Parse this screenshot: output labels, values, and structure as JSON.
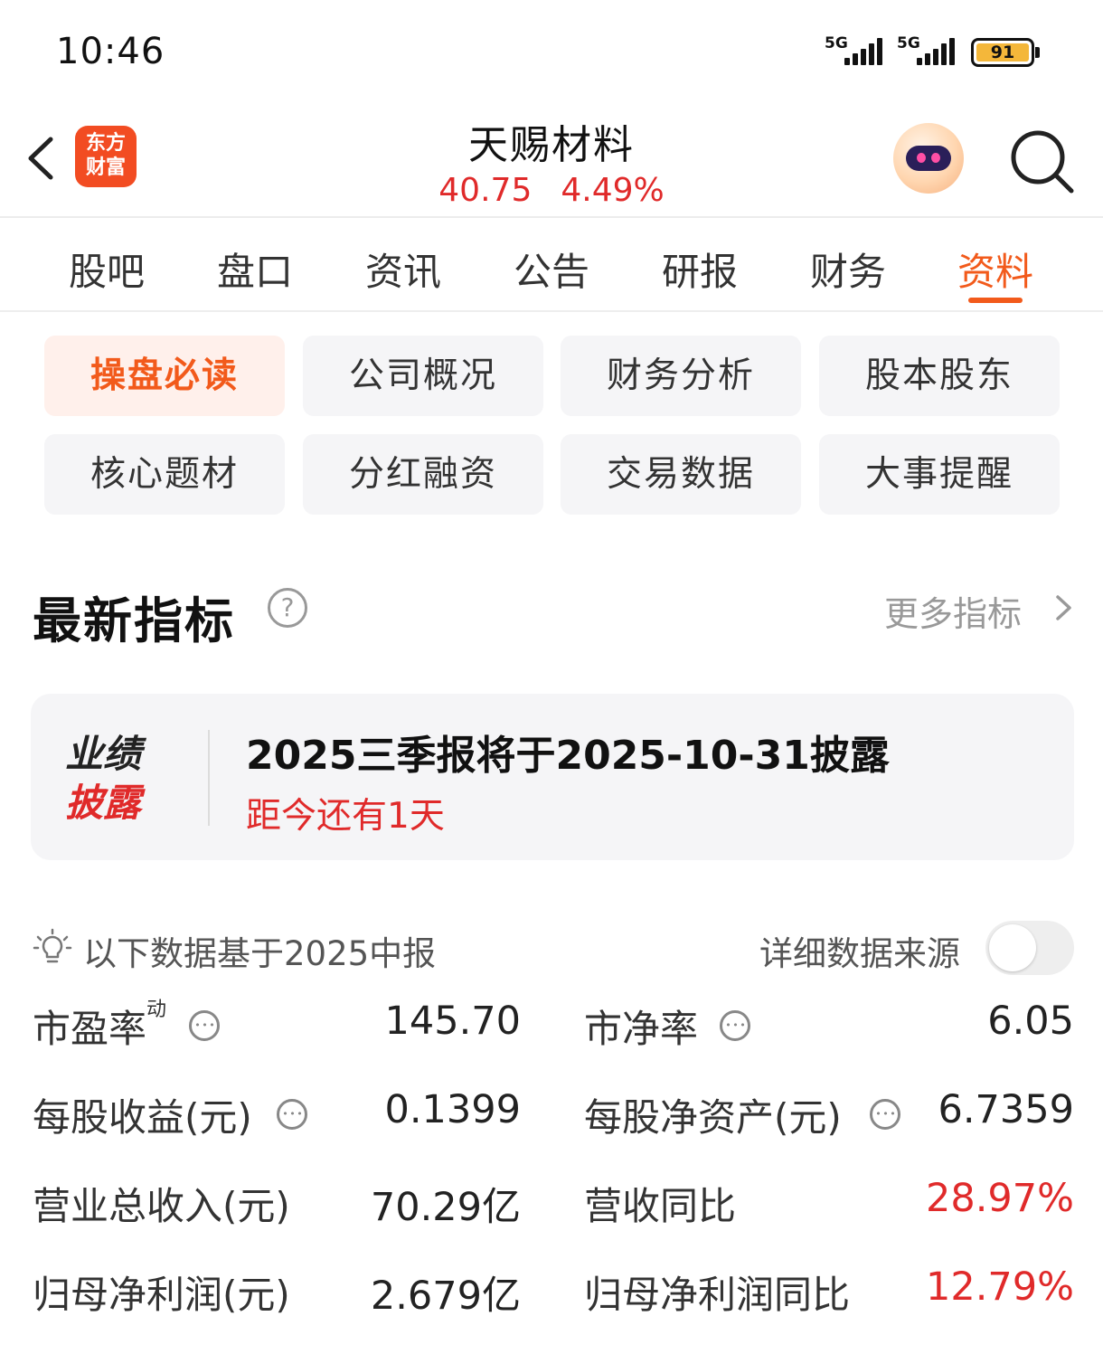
{
  "status_bar": {
    "time": "10:46",
    "signal_1": "5G",
    "signal_2": "5G",
    "battery": "91"
  },
  "header": {
    "logo_line1": "东方",
    "logo_line2": "财富",
    "stock_name": "天赐材料",
    "price": "40.75",
    "change_pct": "4.49%"
  },
  "tabs": [
    {
      "label": "股吧"
    },
    {
      "label": "盘口"
    },
    {
      "label": "资讯"
    },
    {
      "label": "公告"
    },
    {
      "label": "研报"
    },
    {
      "label": "财务"
    },
    {
      "label": "资料",
      "active": true
    }
  ],
  "sub_nav": [
    {
      "label": "操盘必读",
      "active": true
    },
    {
      "label": "公司概况"
    },
    {
      "label": "财务分析"
    },
    {
      "label": "股本股东"
    },
    {
      "label": "核心题材"
    },
    {
      "label": "分红融资"
    },
    {
      "label": "交易数据"
    },
    {
      "label": "大事提醒"
    }
  ],
  "section": {
    "title": "最新指标",
    "help": "?",
    "more": "更多指标"
  },
  "disclosure": {
    "badge_line1": "业绩",
    "badge_line2": "披露",
    "title": "2025三季报将于2025-10-31披露",
    "countdown": "距今还有1天"
  },
  "basis": {
    "text": "以下数据基于2025中报",
    "source_label": "详细数据来源",
    "source_toggle_on": false
  },
  "metrics": {
    "pe_label": "市盈率",
    "pe_sup": "动",
    "pe_value": "145.70",
    "pb_label": "市净率",
    "pb_value": "6.05",
    "eps_label": "每股收益(元)",
    "eps_value": "0.1399",
    "bvps_label": "每股净资产(元)",
    "bvps_value": "6.7359",
    "revenue_label": "营业总收入(元)",
    "revenue_value": "70.29亿",
    "revenue_yoy_label": "营收同比",
    "revenue_yoy_value": "28.97%",
    "net_profit_label": "归母净利润(元)",
    "net_profit_value": "2.679亿",
    "net_profit_yoy_label": "归母净利润同比",
    "net_profit_yoy_value": "12.79%"
  },
  "colors": {
    "accent": "#f25a1b",
    "up_red": "#e02a2a",
    "card_bg": "#f5f5f7"
  }
}
